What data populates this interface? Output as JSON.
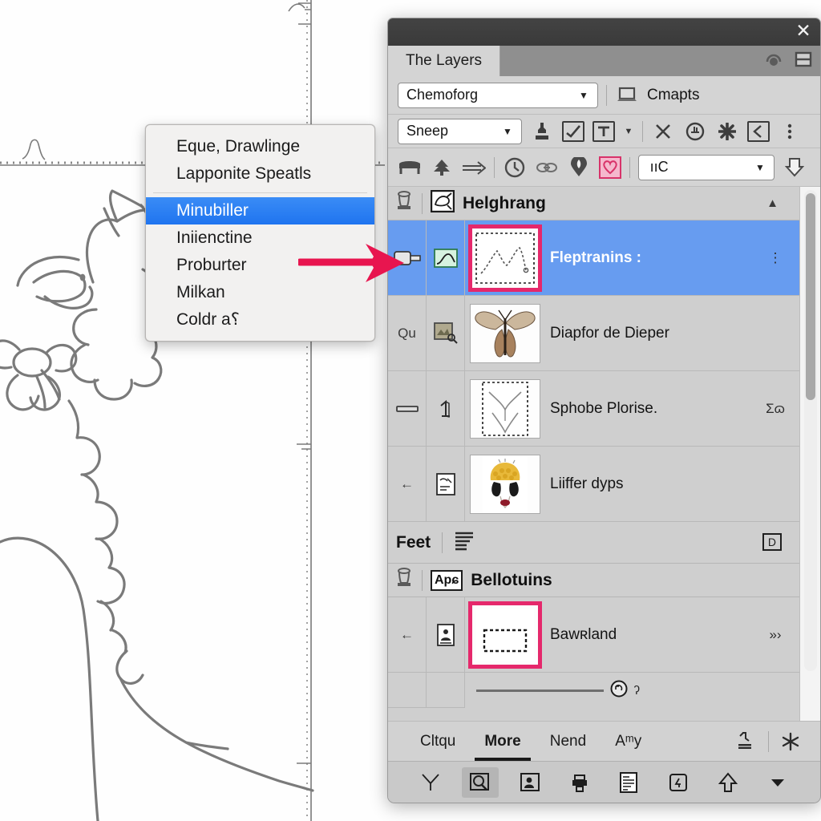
{
  "canvas": {
    "description": "line-art sketch of a fluffy animal head with flower, dotted ruler guides",
    "guide_color": "#7f7f7f"
  },
  "context_menu": {
    "items": [
      {
        "label": "Eque, Drawlinge",
        "selected": false,
        "separator_after": false
      },
      {
        "label": "Lapponite Speatls",
        "selected": false,
        "separator_after": true
      },
      {
        "label": "Minubiller",
        "selected": true,
        "separator_after": false
      },
      {
        "label": "Iniienctine",
        "selected": false,
        "separator_after": false
      },
      {
        "label": "Proburter",
        "selected": false,
        "separator_after": false
      },
      {
        "label": "Milkan",
        "selected": false,
        "separator_after": false
      },
      {
        "label": "Coldr a⸮",
        "selected": false,
        "separator_after": false
      }
    ],
    "highlight_color": "#2f82f2"
  },
  "annotation": {
    "arrow_color": "#e8154f",
    "arrow_name": "pointer-arrow"
  },
  "panel": {
    "close_label": "✕",
    "tab": {
      "label": "The Layers"
    },
    "tab_icons": [
      "headphones-icon",
      "split-view-icon"
    ],
    "row1": {
      "combo_value": "Chemoforg",
      "combo_caret": "▼",
      "laptop_icon": "laptop-icon",
      "laptop_label": "Cmapts"
    },
    "row2": {
      "combo_value": "Sneep",
      "combo_caret": "▼",
      "icons": [
        "stamp-icon",
        "checkmark-brush-icon",
        "text-tool-icon"
      ],
      "caret": "▼",
      "right_icons": [
        "close-x-icon",
        "stamp-circle-icon",
        "asterisk-icon",
        "collapse-left-icon",
        "more-vertical-icon"
      ]
    },
    "row3": {
      "icons_left": [
        "bench-icon",
        "tree-icon",
        "arrow-right-icon"
      ],
      "icons_mid": [
        "clock-icon",
        "link-icon",
        "pin-icon",
        "pink-heart-icon"
      ],
      "combo_value": " ııC",
      "combo_caret": "▼",
      "cursor_icon": "cursor-arrow-icon"
    },
    "groups": [
      {
        "name": "group-helghrang",
        "title": "Helghrang",
        "lamp_icon": "lamp-icon",
        "badge_icon": "sketch-badge-icon",
        "caret": "▲",
        "rows": [
          {
            "name": "layer-fleptranins",
            "left": "tag-icon",
            "kind": "chart-thumb-icon",
            "thumb": "line-chart-thumb",
            "label": "Fleptranins :",
            "right": "⋮",
            "selected": true,
            "thumb_highlight": true
          },
          {
            "name": "layer-diapfor-de-dieper",
            "left": "Qu",
            "kind": "image-search-icon",
            "thumb": "butterfly-thumb",
            "label": "Diapfor de Dieper",
            "right": "",
            "selected": false,
            "thumb_highlight": false
          },
          {
            "name": "layer-sphobe-plorise",
            "left": "dash-icon",
            "kind": "number-one-icon",
            "thumb": "heart-outline-thumb",
            "label": "Sphobe Plorise.",
            "right": "Σɷ",
            "selected": false,
            "thumb_highlight": false
          },
          {
            "name": "layer-liiffer-dyps",
            "left": "←",
            "kind": "note-icon",
            "thumb": "face-portrait-thumb",
            "label": "Liiffer dyps",
            "right": "",
            "selected": false,
            "thumb_highlight": false
          }
        ],
        "subbar": {
          "title": "Feet",
          "list_icon": "list-lines-icon",
          "right_badge": "D"
        }
      },
      {
        "name": "group-bellotuins",
        "title": "Bellotuins",
        "lamp_icon": "lamp-icon",
        "badge_icon": "Apɕ",
        "caret": "",
        "rows": [
          {
            "name": "layer-bawrland",
            "left": "←",
            "kind": "portrait-icon",
            "thumb": "dashed-rect-thumb",
            "label": "Bawʀland",
            "right": "»›",
            "selected": false,
            "thumb_highlight": true
          }
        ],
        "subbar": null
      }
    ],
    "slider": {
      "value_label": "ʔ",
      "handle_icon": "reset-circle-icon"
    },
    "footer_tabs": [
      {
        "label": "Cltqu",
        "active": false
      },
      {
        "label": "More",
        "active": true
      },
      {
        "label": "Nend",
        "active": false
      },
      {
        "label": "Aᵐy",
        "active": false
      }
    ],
    "footer_tabs_right_icons": [
      "stamp-table-icon",
      "asterisk-small-icon"
    ],
    "footer_buttons": [
      {
        "name": "y-tool-button",
        "glyph": "Y",
        "active": false
      },
      {
        "name": "magnify-layer-button",
        "glyph": "⌘",
        "active": true
      },
      {
        "name": "portrait-frame-button",
        "glyph": "▣",
        "active": false
      },
      {
        "name": "printer-button",
        "glyph": "⎙",
        "active": false
      },
      {
        "name": "document-button",
        "glyph": "▤",
        "active": false
      },
      {
        "name": "four-box-button",
        "glyph": "4",
        "active": false
      },
      {
        "name": "upload-arrow-button",
        "glyph": "↑",
        "active": false
      },
      {
        "name": "dropdown-caret-button",
        "glyph": "▼",
        "active": false
      }
    ],
    "scrollbar": {
      "name": "layer-list-scrollbar"
    }
  }
}
